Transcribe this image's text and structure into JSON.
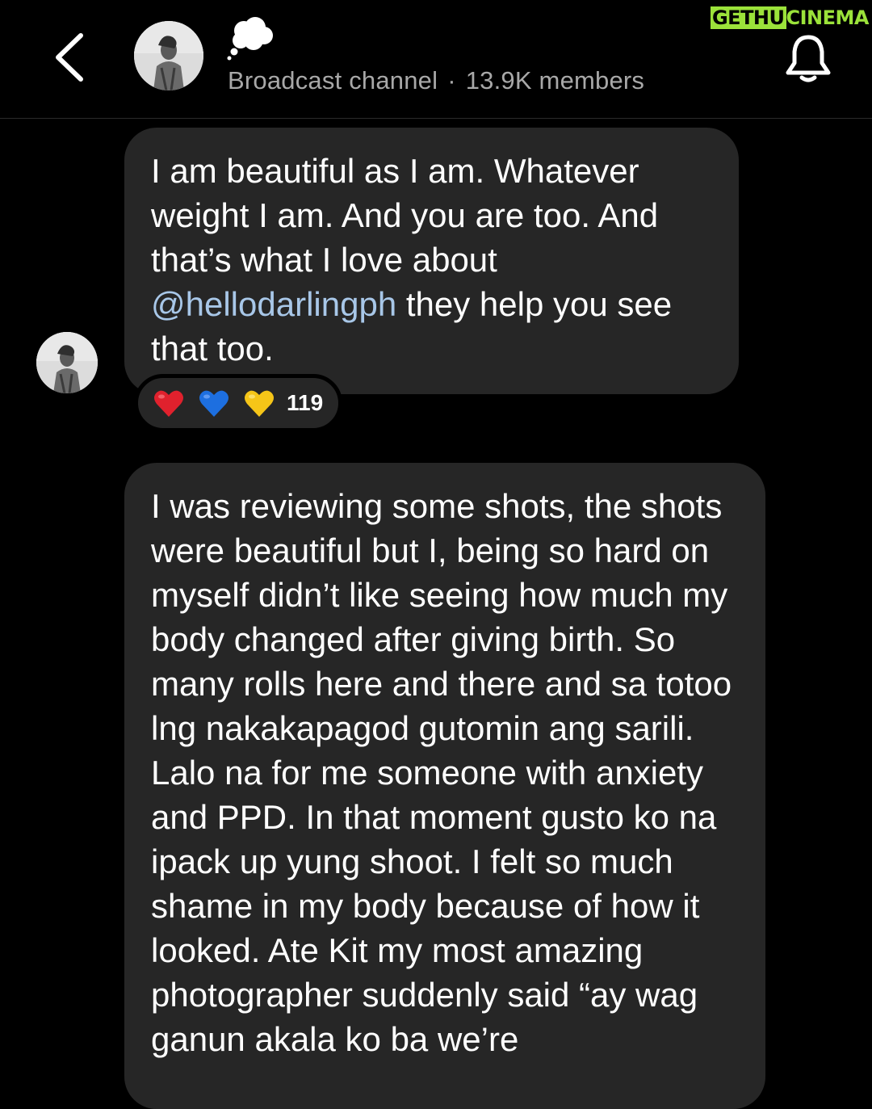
{
  "header": {
    "subtitle_type": "Broadcast channel",
    "subtitle_sep": "·",
    "subtitle_members": "13.9K members",
    "channel_emoji": "thought-balloon",
    "back_icon": "chevron-left-icon",
    "bell_icon": "bell-icon"
  },
  "watermark": {
    "part1": "GETHU",
    "part2": "CINEMA"
  },
  "messages": [
    {
      "text_before": "I am beautiful as I am. Whatever weight I am. And you are too. And that’s what I love about ",
      "mention": "@hellodarlingph",
      "text_after": " they help you see that too.",
      "reactions": {
        "emojis": [
          "red-heart",
          "blue-heart",
          "yellow-heart"
        ],
        "count": "119"
      }
    },
    {
      "text": "I was reviewing some shots, the shots were beautiful but I, being so hard on myself didn’t like seeing how much my body changed after giving birth. So many rolls here and there and sa totoo lng nakakapagod gutomin ang sarili. Lalo na for me someone with anxiety and PPD. In that moment gusto ko na ipack up yung shoot. I felt so much shame in my body because of how it looked. Ate Kit my most amazing photographer suddenly said “ay wag ganun akala ko ba we’re"
    }
  ],
  "colors": {
    "background": "#000000",
    "bubble": "#262626",
    "subtitle": "#a8a8a8",
    "mention": "#a8c7e8",
    "watermark": "#9be23a"
  }
}
